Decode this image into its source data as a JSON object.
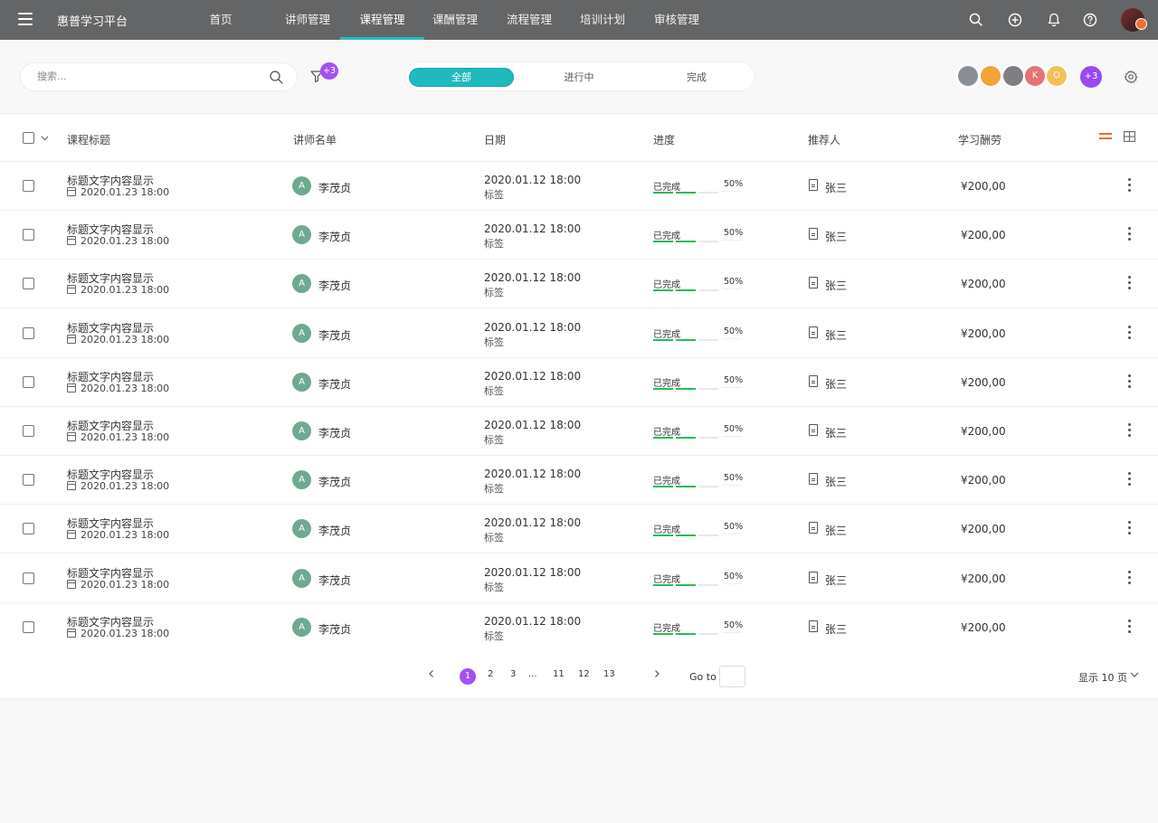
{
  "app": {
    "brand": "惠普学习平台",
    "nav": [
      {
        "label": "首页",
        "active": false
      },
      {
        "label": "讲师管理",
        "active": false
      },
      {
        "label": "课程管理",
        "active": true
      },
      {
        "label": "课酬管理",
        "active": false
      },
      {
        "label": "流程管理",
        "active": false
      },
      {
        "label": "培训计划",
        "active": false
      },
      {
        "label": "审核管理",
        "active": false
      }
    ],
    "icons": [
      "search-icon",
      "add-circle-icon",
      "bell-icon",
      "help-icon"
    ]
  },
  "toolbar": {
    "search_placeholder": "搜索...",
    "filter_badge": "+3",
    "segments": [
      "全部",
      "进行中",
      "完成"
    ],
    "active_segment": "全部",
    "avatars": [
      {
        "initial": "",
        "color": "#8a8f95"
      },
      {
        "initial": "",
        "color": "#f2a33a"
      },
      {
        "initial": "",
        "color": "#7d7f85"
      },
      {
        "initial": "K",
        "color": "#e57373"
      },
      {
        "initial": "O",
        "color": "#f6c05a"
      }
    ],
    "more_badge": "+3"
  },
  "table": {
    "columns": [
      "课程标题",
      "讲师名单",
      "日期",
      "进度",
      "推荐人",
      "学习酬劳"
    ],
    "rows": [
      {
        "title": "标题文字内容显示",
        "created": "2020.01.23 18:00",
        "teacher_initial": "A",
        "teacher": "李茂贞",
        "date": "2020.01.12 18:00",
        "tag": "标签",
        "status": "已完成",
        "progress": "50%",
        "referrer": "张三",
        "pay": "¥200,00"
      },
      {
        "title": "标题文字内容显示",
        "created": "2020.01.23 18:00",
        "teacher_initial": "A",
        "teacher": "李茂贞",
        "date": "2020.01.12 18:00",
        "tag": "标签",
        "status": "已完成",
        "progress": "50%",
        "referrer": "张三",
        "pay": "¥200,00"
      },
      {
        "title": "标题文字内容显示",
        "created": "2020.01.23 18:00",
        "teacher_initial": "A",
        "teacher": "李茂贞",
        "date": "2020.01.12 18:00",
        "tag": "标签",
        "status": "已完成",
        "progress": "50%",
        "referrer": "张三",
        "pay": "¥200,00"
      },
      {
        "title": "标题文字内容显示",
        "created": "2020.01.23 18:00",
        "teacher_initial": "A",
        "teacher": "李茂贞",
        "date": "2020.01.12 18:00",
        "tag": "标签",
        "status": "已完成",
        "progress": "50%",
        "referrer": "张三",
        "pay": "¥200,00"
      },
      {
        "title": "标题文字内容显示",
        "created": "2020.01.23 18:00",
        "teacher_initial": "A",
        "teacher": "李茂贞",
        "date": "2020.01.12 18:00",
        "tag": "标签",
        "status": "已完成",
        "progress": "50%",
        "referrer": "张三",
        "pay": "¥200,00"
      },
      {
        "title": "标题文字内容显示",
        "created": "2020.01.23 18:00",
        "teacher_initial": "A",
        "teacher": "李茂贞",
        "date": "2020.01.12 18:00",
        "tag": "标签",
        "status": "已完成",
        "progress": "50%",
        "referrer": "张三",
        "pay": "¥200,00"
      },
      {
        "title": "标题文字内容显示",
        "created": "2020.01.23 18:00",
        "teacher_initial": "A",
        "teacher": "李茂贞",
        "date": "2020.01.12 18:00",
        "tag": "标签",
        "status": "已完成",
        "progress": "50%",
        "referrer": "张三",
        "pay": "¥200,00"
      },
      {
        "title": "标题文字内容显示",
        "created": "2020.01.23 18:00",
        "teacher_initial": "A",
        "teacher": "李茂贞",
        "date": "2020.01.12 18:00",
        "tag": "标签",
        "status": "已完成",
        "progress": "50%",
        "referrer": "张三",
        "pay": "¥200,00"
      },
      {
        "title": "标题文字内容显示",
        "created": "2020.01.23 18:00",
        "teacher_initial": "A",
        "teacher": "李茂贞",
        "date": "2020.01.12 18:00",
        "tag": "标签",
        "status": "已完成",
        "progress": "50%",
        "referrer": "张三",
        "pay": "¥200,00"
      },
      {
        "title": "标题文字内容显示",
        "created": "2020.01.23 18:00",
        "teacher_initial": "A",
        "teacher": "李茂贞",
        "date": "2020.01.12 18:00",
        "tag": "标签",
        "status": "已完成",
        "progress": "50%",
        "referrer": "张三",
        "pay": "¥200,00"
      }
    ]
  },
  "pagination": {
    "pages": [
      "1",
      "2",
      "3",
      "...",
      "11",
      "12",
      "13"
    ],
    "current": "1",
    "goto_label": "Go to",
    "page_size": "显示 10 页"
  },
  "colors": {
    "topbar": "#646566",
    "accent_teal": "#20b9bd",
    "accent_purple": "#a451f0",
    "progress_green": "#2eb85c",
    "accent_orange": "#f06b2a"
  }
}
